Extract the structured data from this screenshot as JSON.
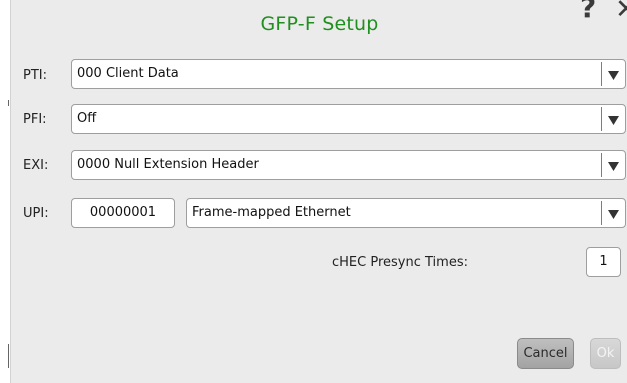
{
  "dialog": {
    "title": "GFP-F Setup",
    "help_icon": "?",
    "close_icon": "✕"
  },
  "fields": {
    "pti": {
      "label": "PTI:",
      "value": "000 Client Data"
    },
    "pfi": {
      "label": "PFI:",
      "value": "Off"
    },
    "exi": {
      "label": "EXI:",
      "value": "0000 Null Extension Header"
    },
    "upi": {
      "label": "UPI:",
      "code": "00000001",
      "value": "Frame-mapped Ethernet"
    }
  },
  "chec": {
    "label": "cHEC Presync Times:",
    "value": "1"
  },
  "buttons": {
    "cancel": "Cancel",
    "ok": "Ok"
  },
  "colors": {
    "title": "#1f8f1f",
    "dialog_bg": "#ebebeb"
  }
}
